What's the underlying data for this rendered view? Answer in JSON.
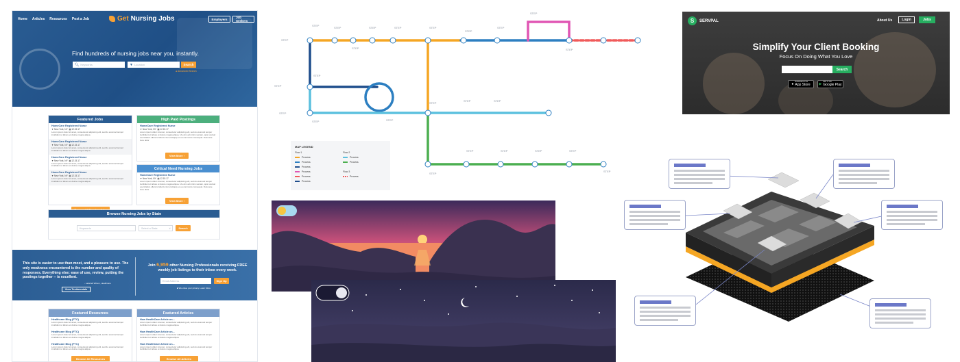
{
  "nursing": {
    "nav": [
      "Home",
      "Articles",
      "Resources",
      "Post a Job"
    ],
    "logo_prefix": "Get",
    "logo_text": "Nursing Jobs",
    "employers_label": "Employers",
    "jobseekers_label": "Job Seekers",
    "tagline": "Find hundreds of nursing jobs near you, instantly.",
    "keywords_placeholder": "Keywords",
    "location_placeholder": "Location",
    "search_label": "Search",
    "advanced_search": "Advanced Search",
    "featured_jobs": {
      "title": "Featured Jobs",
      "jobs": [
        {
          "title": "HomeCare Registered Nurse",
          "location": "New York, NY",
          "date": "12.15.17",
          "desc": "Lorem ipsum dolor sit amet, consectetur adipiscing elit, sed do eiusmod tempor incididunt ut labore et dolore magna aliqua."
        },
        {
          "title": "HomeCare Registered Nurse",
          "location": "New York, NY",
          "date": "12.15.17",
          "desc": "Lorem ipsum dolor sit amet, consectetur adipiscing elit, sed do eiusmod tempor incididunt ut labore et dolore magna aliqua."
        },
        {
          "title": "HomeCare Registered Nurse",
          "location": "New York, NY",
          "date": "12.15.17",
          "desc": "Lorem ipsum dolor sit amet, consectetur adipiscing elit, sed do eiusmod tempor incididunt ut labore et dolore magna aliqua."
        },
        {
          "title": "HomeCare Registered Nurse",
          "location": "New York, NY",
          "date": "12.15.17",
          "desc": "Lorem ipsum dolor sit amet, consectetur adipiscing elit, sed do eiusmod tempor incididunt ut labore et dolore magna aliqua."
        }
      ],
      "button": "Browse All Nursing Jobs"
    },
    "high_paid": {
      "title": "High Paid Postings",
      "job": {
        "title": "HomeCare Registered Nurse",
        "location": "New York, NY",
        "date": "12.15.17",
        "desc": "Lorem ipsum dolor sit amet, consectetur adipiscing elit, sed do eiusmod tempor incididunt ut labore et dolore magna aliqua. Ut enim ad minim veniam, quis nostrud exercitation ullamco laboris nisi ut aliquip ex ea commodo consequat. Duis aute irure dolor"
      },
      "button": "View More"
    },
    "critical": {
      "title": "Critical Need Nursing Jobs",
      "job": {
        "title": "HomeCare Registered Nurse",
        "location": "New York, NY",
        "date": "12.15.17",
        "desc": "Lorem ipsum dolor sit amet, consectetur adipiscing elit, sed do eiusmod tempor incididunt ut labore et dolore magna aliqua. Ut enim ad minim veniam, quis nostrud exercitation ullamco laboris nisi ut aliquip ex ea commodo consequat. Duis aute irure dolor"
      },
      "button": "View More"
    },
    "browse_state": {
      "title": "Browse Nursing Jobs by State",
      "keywords_placeholder": "Keywords",
      "state_placeholder": "Select a State",
      "button": "Search"
    },
    "testimonial": {
      "quote": "This site is easier to use than most, and a pleasure to use. The only weakness encountered is the number and quality of responses. Everything else: ease of use, review, putting the postings together -- is excellent.",
      "author": "- Lakshell Wilson, Healthcare",
      "button": "View Testimonials"
    },
    "signup": {
      "pre": "Join",
      "count": "6,959",
      "post": "other Nursing Professionals receiving FREE weekly job listings to their inbox every week.",
      "email_placeholder": "Email Address",
      "button": "Sign Up",
      "privacy": "We value your privacy. Learn More."
    },
    "resources": {
      "title": "Featured Resources",
      "items": [
        {
          "title": "Healthcare Blog (FTC)",
          "desc": "Lorem ipsum dolor sit amet, consectetur adipiscing elit, sed do eiusmod tempor incididunt ut labore et dolore magna aliqua."
        },
        {
          "title": "Healthcare Blog (FTC)",
          "desc": "Lorem ipsum dolor sit amet, consectetur adipiscing elit, sed do eiusmod tempor incididunt ut labore et dolore magna aliqua."
        },
        {
          "title": "Healthcare Blog (FTC)",
          "desc": "Lorem ipsum dolor sit amet, consectetur adipiscing elit, sed do eiusmod tempor incididunt ut labore et dolore magna aliqua."
        }
      ],
      "button": "Browse All Resources"
    },
    "articles": {
      "title": "Featured Articles",
      "items": [
        {
          "title": "How HealthCare Article on...",
          "desc": "Lorem ipsum dolor sit amet, consectetur adipiscing elit, sed do eiusmod tempor incididunt ut labore et dolore magna aliqua."
        },
        {
          "title": "How HealthCare Article on...",
          "desc": "Lorem ipsum dolor sit amet, consectetur adipiscing elit, sed do eiusmod tempor incididunt ut labore et dolore magna aliqua."
        },
        {
          "title": "How HealthCare Article on...",
          "desc": "Lorem ipsum dolor sit amet, consectetur adipiscing elit, sed do eiusmod tempor incididunt ut labore et dolore magna aliqua."
        }
      ],
      "button": "Browse All Articles"
    },
    "colors": {
      "primary": "#2a5c92",
      "accent": "#f7a135",
      "green": "#4caf7d",
      "lightblue": "#4a8fd0",
      "fadedblue": "#7d9fcb"
    }
  },
  "metro": {
    "step_label": "STEP",
    "legend": {
      "title": "MAP LEGEND",
      "flow1": "Flow 1",
      "flow2": "Flow 2",
      "flow3": "Flow 3",
      "process": "Process"
    },
    "colors": {
      "orange": "#f5a623",
      "blue": "#2d7fc1",
      "darkblue": "#1f4e8c",
      "cyan": "#5bc0de",
      "green": "#4caf50",
      "pink": "#e056b4",
      "red": "#f05a5a"
    }
  },
  "servpal": {
    "logo_letter": "S",
    "logo_text": "SERVPAL",
    "about": "About Us",
    "login": "Login",
    "jobs": "Jobs",
    "headline": "Simplify Your Client Booking",
    "subhead": "Focus On Doing What You Love",
    "search": "Search",
    "appstore_small": "Download on the",
    "appstore": "App Store",
    "googleplay_small": "GET IT ON",
    "googleplay": "Google Play",
    "accent": "#27ae60"
  },
  "scenes": {
    "day_toggle": "sun-icon",
    "night_toggle": "moon-icon"
  },
  "chip": {
    "card_accent": "#6b78c8",
    "pin_color": "#f5a623"
  }
}
